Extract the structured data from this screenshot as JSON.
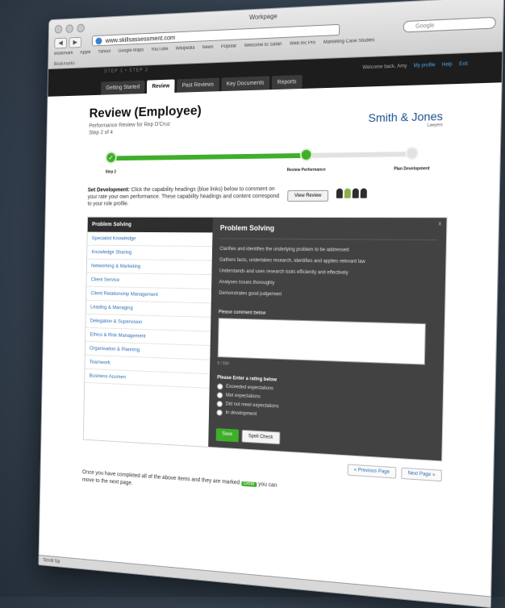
{
  "browser": {
    "window_title": "Workpage",
    "url": "www.skillsassessment.com",
    "search_placeholder": "Google",
    "bookmarks": [
      "Bookmark",
      "Apple",
      "Yahoo!",
      "Google Maps",
      "YouTube",
      "Wikipedia",
      "News",
      "Popular",
      "Welcome to Safari",
      "Web Inc Pro",
      "Marketing Case Studies"
    ],
    "tabs_text": "Bookmarks",
    "status": "Scroll Up"
  },
  "site": {
    "crumb": "STEP 1 • STEP 2",
    "tabs": [
      {
        "label": "Getting Started"
      },
      {
        "label": "Review"
      },
      {
        "label": "Past Reviews"
      },
      {
        "label": "Key Documents"
      },
      {
        "label": "Reports"
      }
    ],
    "user": {
      "welcome": "Welcome back, Amy",
      "link1": "My profile",
      "link2": "Help",
      "link3": "Exit"
    }
  },
  "page": {
    "title": "Review (Employee)",
    "subtitle_line1": "Performance Review for Rep D'Cruz",
    "subtitle_line2": "Step 2 of 4",
    "brand": "Smith & Jones",
    "brand_sub": "Lawyers"
  },
  "progress": {
    "fraction": 0.66,
    "steps": [
      {
        "label": "Step 2",
        "state": "done"
      },
      {
        "label": "Review Performance",
        "state": "current"
      },
      {
        "label": "Plan Development",
        "state": "todo"
      }
    ]
  },
  "instructions": {
    "lead": "Set Development:",
    "text": "Click the capability headings (blue links) below to comment on your rate your own performance. These capability headings and content correspond to your role profile.",
    "view_button": "View Review"
  },
  "categories": {
    "header": "Problem Solving",
    "items": [
      "Specialist Knowledge",
      "Knowledge Sharing",
      "Networking & Marketing",
      "Client Service",
      "Client Relationship Management",
      "Leading & Managing",
      "Delegation & Supervision",
      "Ethics & Risk Management",
      "Organisation & Planning",
      "Teamwork",
      "Business Acumen"
    ]
  },
  "panel": {
    "title": "Problem Solving",
    "close": "x",
    "criteria": [
      "Clarifies and identifies the underlying problem to be addressed",
      "Gathers facts, undertakes research, identifies and applies relevant law",
      "Understands and uses research tools efficiently and effectively",
      "Analyses issues thoroughly",
      "Demonstrates good judgement"
    ],
    "comment_label": "Please comment below",
    "counter": "0 / 500",
    "rating_label": "Please Enter a rating below",
    "ratings": [
      "Exceeded expectations",
      "Met expectations",
      "Did not meet expectations",
      "In development"
    ],
    "save": "Save",
    "spell": "Spell Check"
  },
  "pager": {
    "prev": "« Previous Page",
    "next": "Next Page »"
  },
  "footer": {
    "part1": "Once you have completed all of the above items and they are marked",
    "badge": "Done",
    "part2": "you can move to the next page."
  }
}
